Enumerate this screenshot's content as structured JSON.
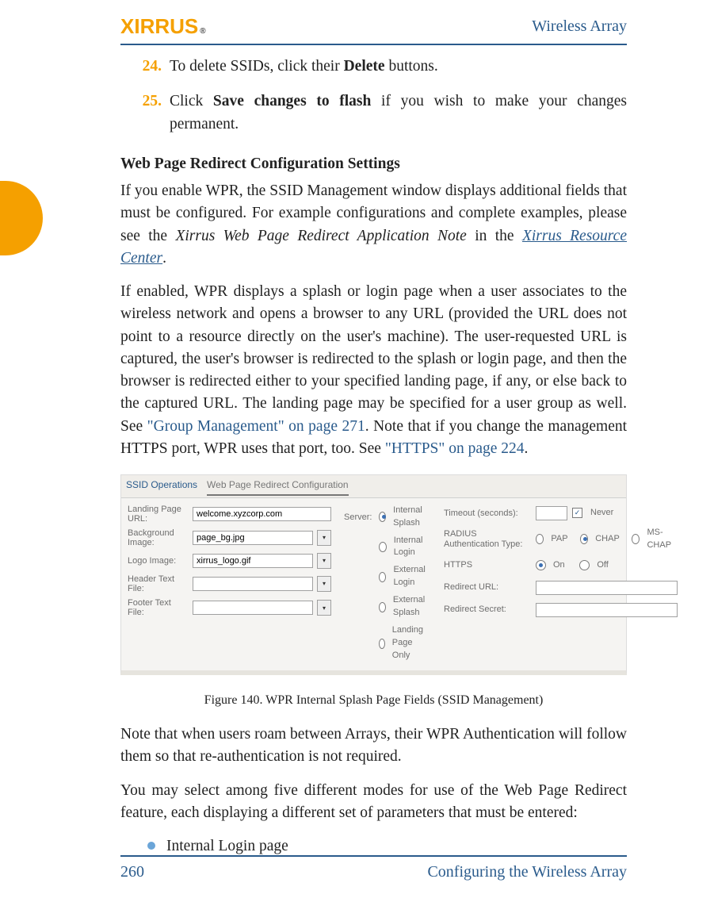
{
  "header": {
    "product": "Wireless Array"
  },
  "logo": {
    "prefix": "X",
    "chars": "I",
    "rest": "RRUS",
    "reg": "®"
  },
  "steps": [
    {
      "num": "24.",
      "pre": "To delete SSIDs, click their ",
      "bold": "Delete",
      "post": " buttons."
    },
    {
      "num": "25.",
      "pre": "Click ",
      "bold": "Save changes to flash",
      "post": " if you wish to make your changes permanent."
    }
  ],
  "section": {
    "heading": "Web Page Redirect Configuration Settings"
  },
  "p1": {
    "a": "If you enable WPR, the SSID Management window displays additional fields that must be configured. For example configurations and complete examples, please see the ",
    "ital": "Xirrus Web Page Redirect Application Note",
    "b": " in the ",
    "link": "Xirrus Resource Center",
    "c": "."
  },
  "p2": {
    "a": "If enabled, WPR displays a splash or login page when a user associates to the wireless network and opens a browser to any URL (provided the URL does not point to a resource directly on the user's machine). The user-requested URL is captured, the user's browser is redirected to the splash or login page, and then the browser is redirected either to your specified landing page, if any, or else back to the captured URL. The landing page may be specified for a user group as well. See ",
    "link1": "\"Group Management\" on page 271",
    "b": ". Note that if you change the management HTTPS port, WPR uses that port, too. See ",
    "link2": "\"HTTPS\" on page 224",
    "c": "."
  },
  "screenshot": {
    "tabs": [
      "SSID Operations",
      "Web Page Redirect Configuration"
    ],
    "col1": {
      "landing_lbl": "Landing Page URL:",
      "landing_val": "welcome.xyzcorp.com",
      "bg_lbl": "Background Image:",
      "bg_val": "page_bg.jpg",
      "logo_lbl": "Logo Image:",
      "logo_val": "xirrus_logo.gif",
      "hdr_lbl": "Header Text File:",
      "hdr_val": "",
      "ftr_lbl": "Footer Text File:",
      "ftr_val": ""
    },
    "col2": {
      "server_lbl": "Server:",
      "opts": [
        "Internal Splash",
        "Internal Login",
        "External Login",
        "External Splash",
        "Landing Page Only"
      ]
    },
    "col3": {
      "timeout_lbl": "Timeout (seconds):",
      "never": "Never",
      "rad_lbl": "RADIUS Authentication Type:",
      "rad_opts": [
        "PAP",
        "CHAP",
        "MS-CHAP"
      ],
      "https_lbl": "HTTPS",
      "https_opts": [
        "On",
        "Off"
      ],
      "redirect_url_lbl": "Redirect URL:",
      "redirect_secret_lbl": "Redirect Secret:"
    }
  },
  "caption": "Figure 140. WPR Internal Splash Page Fields (SSID Management)",
  "p3": "Note that when users roam between Arrays, their WPR Authentication will follow them so that re-authentication is not required.",
  "p4": "You may select among five different modes for use of the Web Page Redirect feature, each displaying a different set of parameters that must be entered:",
  "bullet1": "Internal Login page",
  "footer": {
    "page": "260",
    "section": "Configuring the Wireless Array"
  }
}
